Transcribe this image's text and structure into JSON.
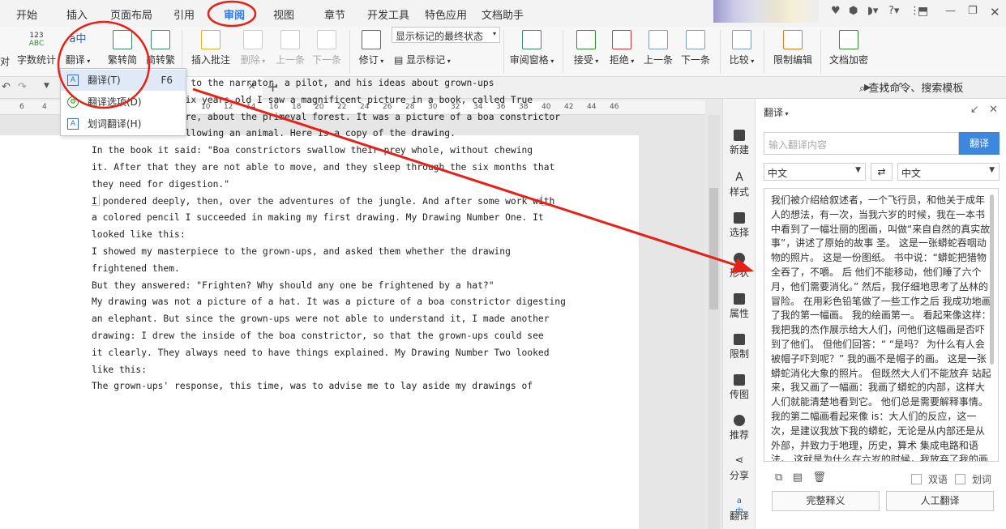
{
  "colors": {
    "accent": "#2b78e4",
    "annotation": "#e62117",
    "translate_button": "#3f87de"
  },
  "menubar": {
    "tabs": [
      "开始",
      "插入",
      "页面布局",
      "引用",
      "审阅",
      "视图",
      "章节",
      "开发工具",
      "特色应用",
      "文档助手"
    ],
    "active_tab": "审阅"
  },
  "ribbon": {
    "buttons": {
      "word_count": "字数统计",
      "translate": "翻译",
      "to_simplified": "繁转简",
      "to_traditional": "简转繁",
      "insert_comment": "插入批注",
      "delete": "删除",
      "prev": "上一条",
      "next": "下一条",
      "revise": "修订",
      "show_markup": "显示标记",
      "review_pane": "审阅窗格",
      "accept": "接受",
      "reject": "拒绝",
      "prev2": "上一条",
      "next2": "下一条",
      "compare": "比较",
      "restrict_edit": "限制编辑",
      "doc_encrypt": "文档加密",
      "cut_left": "对"
    },
    "markup_combo": "显示标记的最终状态",
    "icon_word_count_top": "123",
    "icon_word_count_bottom": "ABC"
  },
  "quickbar": {
    "search": "查找命令、搜索模板",
    "close": "×",
    "add_tab": "+"
  },
  "ruler": {
    "ticks": [
      "6",
      "4",
      "2",
      "",
      "2",
      "4",
      "6",
      "8",
      "10",
      "12",
      "14",
      "16",
      "18",
      "20",
      "22",
      "24",
      "26",
      "28",
      "30",
      "32",
      "34",
      "36",
      "38",
      "40",
      "42",
      "44",
      "46"
    ]
  },
  "dropdown": {
    "items": [
      {
        "label": "翻译(T)",
        "shortcut": "F6",
        "icon": "translate-icon"
      },
      {
        "label": "翻译选项(D)",
        "shortcut": "",
        "icon": "translate-options-icon"
      },
      {
        "label": "划词翻译(H)",
        "shortcut": "",
        "icon": "word-select-translate-icon"
      }
    ]
  },
  "document": {
    "lines": [
      "we are introduced to the narrator, a pilot, and his ideas about grown-ups",
      "Once when I was six years old I saw a magnificent picture in a book, called True",
      "Stories from Nature, about the primeval forest. It was a picture of a boa constrictor",
      "in the act of swallowing an animal. Here is a copy of the drawing.",
      "In the book it said: \"Boa constrictors swallow their prey whole, without chewing",
      "it. After that they are not able to move, and they sleep through the six months that",
      "they need for digestion.\"",
      "I pondered deeply, then, over the adventures of the jungle. And after some work with",
      "a colored pencil I succeeded in making my first drawing. My Drawing Number One. It",
      "looked like this:",
      "I showed my masterpiece to the grown-ups, and asked them whether the drawing",
      "frightened them.",
      "But they answered: \"Frighten? Why should any one be frightened by a hat?\"",
      "My drawing was not a picture of a hat. It was a picture of a boa constrictor digesting",
      "an elephant. But since the grown-ups were not able to understand it, I made another",
      "drawing: I drew the inside of the boa constrictor, so that the grown-ups could see",
      "it clearly. They always need to have things explained. My Drawing Number Two looked",
      "like this:",
      "The grown-ups' response, this time, was to advise me to lay aside my drawings of"
    ]
  },
  "side_tools": [
    "新建",
    "样式",
    "选择",
    "形状",
    "属性",
    "限制",
    "传图",
    "推荐",
    "分享",
    "翻译"
  ],
  "pane": {
    "title": "翻译",
    "input_placeholder": "输入翻译内容",
    "translate_button": "翻译",
    "source_lang": "中文",
    "target_lang": "中文",
    "result_text": "我们被介绍给叙述者，一个飞行员，和他关于成年人的想法，有一次，当我六岁的时候，我在一本书中看到了一幅壮丽的图画，叫做“来自自然的真实故事”，讲述了原始的故事 圣。 这是一张蟒蛇吞咽动物的照片。 这是一份图纸。 书中说：“蟒蛇把猎物全吞了，不嚼。 后 他们不能移动，他们睡了六个月，他们需要消化。” 然后，我仔细地思考了丛林的冒险。 在用彩色铅笔做了一些工作之后 我成功地画了我的第一幅画。 我的绘画第一。 看起来像这样：我把我的杰作展示给大人们，问他们这幅画是否吓到了他们。 但他们回答：“ “是吗？ 为什么有人会被帽子吓到呢？” 我的画不是帽子的画。 这是一张蟒蛇消化大象的照片。 但既然大人们不能放弃 站起来，我又画了一幅画：我画了蟒蛇的内部，这样大人们就能清楚地看到它。 他们总是需要解释事情。 我的第二幅画看起来像 is：大人们的反应，这一次，是建议我放下我的蟒蛇，无论是从内部还是从外部，并致力于地理，历史，算术 集成电路和语法。 这就是为什么在六岁的时候，我放弃了我的画家生涯",
    "bilingual": "双语",
    "word_select": "划词",
    "full_definition": "完整释义",
    "human_translate": "人工翻译"
  }
}
